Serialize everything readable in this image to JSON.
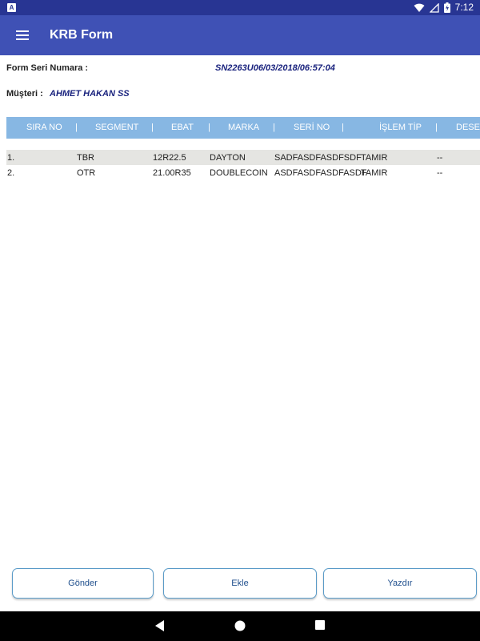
{
  "status_bar": {
    "notification_letter": "A",
    "time": "7:12"
  },
  "app_bar": {
    "title": "KRB Form"
  },
  "form": {
    "serial_label": "Form Seri Numara :",
    "serial_value": "SN2263U06/03/2018/06:57:04",
    "customer_label": "Müşteri :",
    "customer_value": "AHMET HAKAN SS"
  },
  "table": {
    "columns": [
      "SIRA NO",
      "SEGMENT",
      "EBAT",
      "MARKA",
      "SERİ NO",
      "İŞLEM TİP",
      "DESEN"
    ],
    "separator": "|",
    "rows": [
      {
        "sira": "1.",
        "segment": "TBR",
        "ebat": "12R22.5",
        "marka": "DAYTON",
        "seri": "SADFASDFASDFSDF",
        "islem": "TAMIR",
        "desen": "--"
      },
      {
        "sira": "2.",
        "segment": "OTR",
        "ebat": "21.00R35",
        "marka": "DOUBLECOIN",
        "seri": "ASDFASDFASDFASDF",
        "islem": "TAMIR",
        "desen": "--"
      }
    ]
  },
  "buttons": {
    "send": "Gönder",
    "add": "Ekle",
    "print": "Yazdır"
  },
  "nav_bar": {
    "icons": [
      "back-icon",
      "home-icon",
      "recents-icon"
    ]
  },
  "colors": {
    "status_bar": "#283593",
    "app_bar": "#3f51b5",
    "table_header": "#87b7e3",
    "value_text": "#1a237e",
    "selected_row": "#e5e5e2"
  }
}
